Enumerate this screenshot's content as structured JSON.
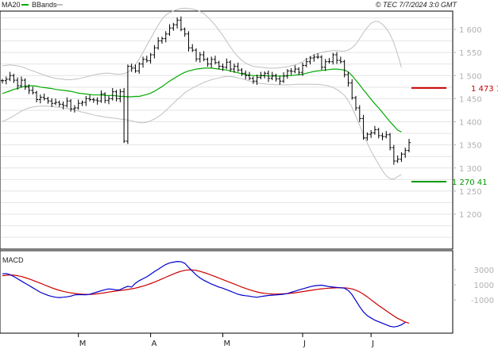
{
  "header": {
    "ma_label": "MA20",
    "bb_label": "BBands",
    "copyright": "© TEC 7/7/2024 3:0 GMT"
  },
  "macd_panel": {
    "title": "MACD",
    "yticks": [
      3000,
      1000,
      -1000
    ]
  },
  "colors": {
    "price_bar": "#000000",
    "ma20": "#00aa00",
    "bbands": "#c0c0c0",
    "macd": "#0000cc",
    "signal": "#cc0000",
    "resistance": "#cc0000",
    "support": "#009900",
    "grid": "#e4e4e4",
    "axis_tick": "#b0b0b0"
  },
  "chart_data": [
    {
      "type": "ohlc",
      "title": "",
      "xlabel": "",
      "ylabel": "",
      "x_tick_labels": [
        "M",
        "A",
        "M",
        "J",
        "J"
      ],
      "yticks": [
        1600,
        1550,
        1500,
        1450,
        1400,
        1350,
        1300,
        1250,
        1200
      ],
      "ytick_labels": [
        "1 600",
        "1 550",
        "1 500",
        "1 450",
        "1 400",
        "1 350",
        "1 300",
        "1 250",
        "1 200"
      ],
      "ylim": [
        1135,
        1680
      ],
      "grid": true,
      "series": [
        {
          "name": "MA20",
          "values": [
            1461,
            1464,
            1467,
            1470,
            1472,
            1475,
            1477,
            1478,
            1478,
            1477,
            1475,
            1474,
            1473,
            1472,
            1470,
            1469,
            1468,
            1467,
            1466,
            1464,
            1462,
            1461,
            1460,
            1459,
            1458,
            1458,
            1458,
            1457,
            1457,
            1457,
            1456,
            1455,
            1455,
            1454,
            1454,
            1455,
            1455,
            1457,
            1459,
            1462,
            1466,
            1471,
            1476,
            1482,
            1488,
            1493,
            1498,
            1503,
            1507,
            1510,
            1512,
            1514,
            1515,
            1516,
            1516,
            1516,
            1515,
            1514,
            1513,
            1512,
            1510,
            1508,
            1506,
            1504,
            1502,
            1501,
            1500,
            1500,
            1500,
            1500,
            1499,
            1499,
            1499,
            1499,
            1499,
            1500,
            1500,
            1501,
            1502,
            1503,
            1505,
            1507,
            1509,
            1510,
            1511,
            1512,
            1513,
            1514,
            1514,
            1513,
            1512,
            1508,
            1500,
            1490,
            1480,
            1469,
            1459,
            1449,
            1439,
            1430,
            1420,
            1410,
            1400,
            1391,
            1382,
            1378
          ]
        },
        {
          "name": "BBands Upper",
          "values": [
            1521,
            1522,
            1523,
            1522,
            1521,
            1519,
            1516,
            1513,
            1510,
            1507,
            1504,
            1501,
            1498,
            1496,
            1494,
            1493,
            1492,
            1491,
            1491,
            1492,
            1493,
            1495,
            1497,
            1499,
            1501,
            1503,
            1504,
            1505,
            1505,
            1504,
            1503,
            1503,
            1504,
            1507,
            1514,
            1524,
            1536,
            1550,
            1565,
            1580,
            1595,
            1609,
            1622,
            1631,
            1636,
            1640,
            1643,
            1645,
            1646,
            1645,
            1644,
            1642,
            1639,
            1634,
            1627,
            1618,
            1609,
            1598,
            1587,
            1574,
            1562,
            1550,
            1541,
            1533,
            1527,
            1523,
            1520,
            1519,
            1518,
            1517,
            1516,
            1516,
            1516,
            1517,
            1518,
            1519,
            1521,
            1523,
            1526,
            1530,
            1535,
            1540,
            1545,
            1548,
            1550,
            1552,
            1553,
            1554,
            1554,
            1553,
            1553,
            1555,
            1560,
            1568,
            1580,
            1593,
            1604,
            1613,
            1617,
            1617,
            1611,
            1602,
            1589,
            1571,
            1546,
            1518
          ]
        },
        {
          "name": "BBands Lower",
          "values": [
            1401,
            1404,
            1408,
            1413,
            1418,
            1423,
            1427,
            1430,
            1432,
            1433,
            1434,
            1434,
            1434,
            1433,
            1432,
            1431,
            1430,
            1429,
            1427,
            1425,
            1423,
            1421,
            1419,
            1417,
            1415,
            1413,
            1412,
            1410,
            1409,
            1408,
            1407,
            1406,
            1405,
            1404,
            1402,
            1400,
            1398,
            1398,
            1399,
            1402,
            1406,
            1411,
            1417,
            1424,
            1432,
            1440,
            1448,
            1455,
            1463,
            1468,
            1473,
            1477,
            1481,
            1485,
            1488,
            1491,
            1493,
            1495,
            1497,
            1498,
            1498,
            1497,
            1495,
            1493,
            1491,
            1488,
            1486,
            1484,
            1483,
            1482,
            1481,
            1481,
            1480,
            1480,
            1480,
            1480,
            1480,
            1481,
            1481,
            1481,
            1481,
            1481,
            1481,
            1481,
            1480,
            1479,
            1477,
            1474,
            1470,
            1464,
            1457,
            1446,
            1431,
            1412,
            1392,
            1372,
            1354,
            1337,
            1322,
            1308,
            1294,
            1283,
            1277,
            1276,
            1281,
            1286
          ]
        }
      ],
      "ohlc": {
        "close": [
          1489,
          1492,
          1500,
          1490,
          1478,
          1490,
          1475,
          1468,
          1463,
          1448,
          1453,
          1450,
          1445,
          1440,
          1442,
          1438,
          1435,
          1445,
          1428,
          1430,
          1440,
          1442,
          1450,
          1448,
          1447,
          1445,
          1460,
          1446,
          1450,
          1465,
          1450,
          1465,
          1358,
          1520,
          1516,
          1510,
          1525,
          1535,
          1532,
          1545,
          1560,
          1575,
          1580,
          1590,
          1603,
          1610,
          1620,
          1600,
          1590,
          1560,
          1555,
          1536,
          1545,
          1535,
          1525,
          1535,
          1528,
          1520,
          1518,
          1529,
          1514,
          1520,
          1512,
          1505,
          1500,
          1494,
          1488,
          1496,
          1500,
          1505,
          1494,
          1500,
          1493,
          1488,
          1499,
          1510,
          1509,
          1514,
          1507,
          1522,
          1530,
          1538,
          1540,
          1540,
          1518,
          1530,
          1530,
          1545,
          1533,
          1530,
          1502,
          1484,
          1452,
          1430,
          1407,
          1365,
          1373,
          1376,
          1383,
          1370,
          1368,
          1372,
          1344,
          1315,
          1319,
          1330,
          1338,
          1355
        ]
      }
    },
    {
      "type": "line",
      "title": "MACD",
      "xlabel": "",
      "ylabel": "",
      "x_tick_labels": [
        "M",
        "A",
        "M",
        "J",
        "J"
      ],
      "yticks": [
        3000,
        1000,
        -1000
      ],
      "ylim": [
        -6000,
        4600
      ],
      "grid": false,
      "series": [
        {
          "name": "MACD",
          "values": [
            2450,
            2500,
            2350,
            2100,
            1800,
            1500,
            1200,
            900,
            600,
            300,
            0,
            -200,
            -400,
            -550,
            -650,
            -700,
            -650,
            -600,
            -500,
            -350,
            -300,
            -320,
            -340,
            -250,
            -100,
            50,
            200,
            350,
            450,
            400,
            300,
            350,
            600,
            800,
            700,
            1200,
            1550,
            1800,
            2050,
            2400,
            2750,
            3050,
            3400,
            3700,
            3900,
            4000,
            4100,
            4050,
            3850,
            3300,
            2800,
            2300,
            1900,
            1600,
            1350,
            1100,
            900,
            700,
            550,
            350,
            150,
            -50,
            -250,
            -380,
            -450,
            -500,
            -600,
            -650,
            -560,
            -480,
            -420,
            -380,
            -350,
            -300,
            -250,
            -150,
            0,
            150,
            300,
            450,
            600,
            750,
            850,
            900,
            950,
            850,
            750,
            700,
            650,
            600,
            550,
            250,
            -300,
            -1100,
            -1900,
            -2600,
            -3100,
            -3400,
            -3700,
            -3900,
            -4100,
            -4300,
            -4500,
            -4600,
            -4500,
            -4300,
            -4000
          ]
        },
        {
          "name": "Signal",
          "values": [
            2200,
            2260,
            2290,
            2270,
            2200,
            2100,
            1950,
            1780,
            1600,
            1400,
            1200,
            1000,
            800,
            600,
            420,
            260,
            130,
            20,
            -70,
            -150,
            -210,
            -250,
            -270,
            -270,
            -250,
            -200,
            -130,
            -50,
            30,
            110,
            180,
            240,
            300,
            380,
            460,
            560,
            680,
            820,
            980,
            1160,
            1350,
            1560,
            1780,
            2000,
            2220,
            2430,
            2630,
            2800,
            2920,
            2980,
            2970,
            2900,
            2780,
            2630,
            2460,
            2270,
            2080,
            1880,
            1690,
            1490,
            1290,
            1090,
            890,
            700,
            520,
            350,
            190,
            50,
            -60,
            -140,
            -190,
            -220,
            -230,
            -220,
            -200,
            -170,
            -120,
            -60,
            10,
            90,
            170,
            250,
            330,
            400,
            460,
            510,
            550,
            580,
            600,
            610,
            600,
            550,
            450,
            280,
            50,
            -250,
            -600,
            -980,
            -1370,
            -1750,
            -2100,
            -2450,
            -2800,
            -3150,
            -3450,
            -3700,
            -3950,
            -4100
          ]
        }
      ]
    }
  ],
  "levels": {
    "resistance": {
      "value": 1473.1,
      "label": "1 473 1"
    },
    "support": {
      "value": 1270.41,
      "label": "1 270 41"
    }
  }
}
